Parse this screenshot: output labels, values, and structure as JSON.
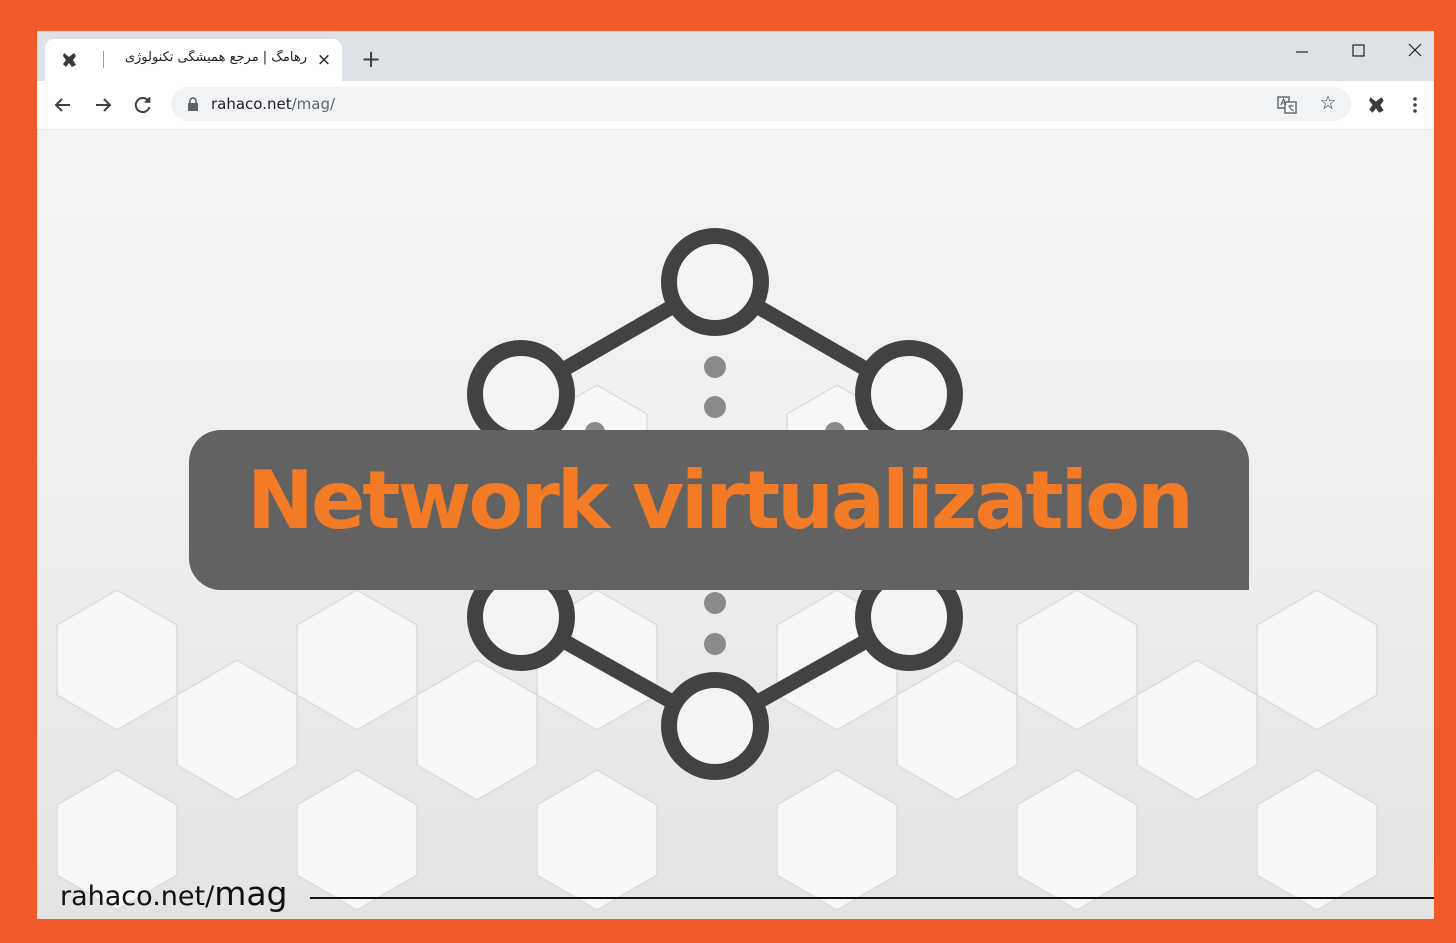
{
  "browser": {
    "tab": {
      "title": "رهامگ | مرجع همیشگی تکنولوژی",
      "close_icon": "×"
    },
    "new_tab_icon": "+",
    "address": {
      "host": "rahaco.net",
      "path": "/mag/"
    }
  },
  "page": {
    "headline": "Network virtualization",
    "watermark": {
      "site": "rahaco.net/",
      "section": "mag"
    }
  },
  "colors": {
    "frame": "#f0592a",
    "headline": "#f47b26",
    "banner": "#626262",
    "node": "#424242"
  }
}
